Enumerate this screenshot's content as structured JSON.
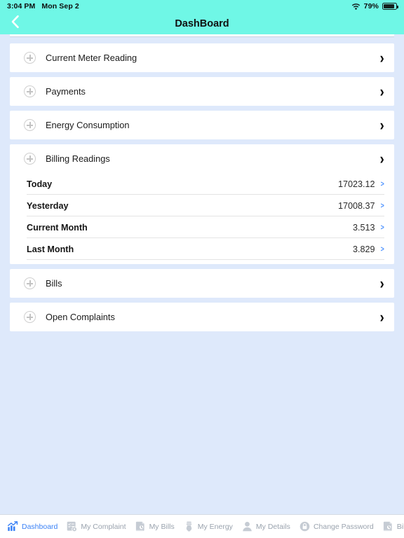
{
  "colors": {
    "header_teal": "#6ff7e6",
    "page_background": "#dee9fb",
    "card_white": "#ffffff",
    "accent_blue": "#3b82f6",
    "value_chevron_blue": "#4a90ff",
    "tab_inactive_gray": "#9aa3ae"
  },
  "status_bar": {
    "time": "3:04 PM",
    "date": "Mon Sep 2",
    "wifi_icon": "wifi-icon",
    "battery_percent": "79%",
    "battery_icon": "battery-icon",
    "battery_level": 79
  },
  "nav": {
    "back_icon": "chevron-left-icon",
    "title": "DashBoard"
  },
  "main": {
    "cards": [
      {
        "label": "Current Meter Reading",
        "plus_icon": "plus-circle-icon",
        "chevron_icon": "chevron-right-icon"
      },
      {
        "label": "Payments",
        "plus_icon": "plus-circle-icon",
        "chevron_icon": "chevron-right-icon"
      },
      {
        "label": "Energy Consumption",
        "plus_icon": "plus-circle-icon",
        "chevron_icon": "chevron-right-icon"
      }
    ],
    "billing_card": {
      "label": "Billing Readings",
      "plus_icon": "plus-circle-icon",
      "chevron_icon": "chevron-right-icon",
      "rows": [
        {
          "name": "Today",
          "value": "17023.12",
          "chevron": ">"
        },
        {
          "name": "Yesterday",
          "value": "17008.37",
          "chevron": ">"
        },
        {
          "name": "Current Month",
          "value": "3.513",
          "chevron": ">"
        },
        {
          "name": "Last Month",
          "value": "3.829",
          "chevron": ">"
        }
      ]
    },
    "cards_bottom": [
      {
        "label": "Bills",
        "plus_icon": "plus-circle-icon",
        "chevron_icon": "chevron-right-icon"
      },
      {
        "label": "Open Complaints",
        "plus_icon": "plus-circle-icon",
        "chevron_icon": "chevron-right-icon"
      }
    ]
  },
  "tabbar": {
    "items": [
      {
        "label": "Dashboard",
        "icon": "chart-bar-icon",
        "active": true
      },
      {
        "label": "My Complaint",
        "icon": "checklist-gear-icon",
        "active": false
      },
      {
        "label": "My Bills",
        "icon": "document-clock-icon",
        "active": false
      },
      {
        "label": "My Energy",
        "icon": "light-bulb-icon",
        "active": false
      },
      {
        "label": "My Details",
        "icon": "person-icon",
        "active": false
      },
      {
        "label": "Change Password",
        "icon": "lock-icon",
        "active": false
      },
      {
        "label": "Billing Reading",
        "icon": "document-clock-icon",
        "active": false
      }
    ]
  }
}
